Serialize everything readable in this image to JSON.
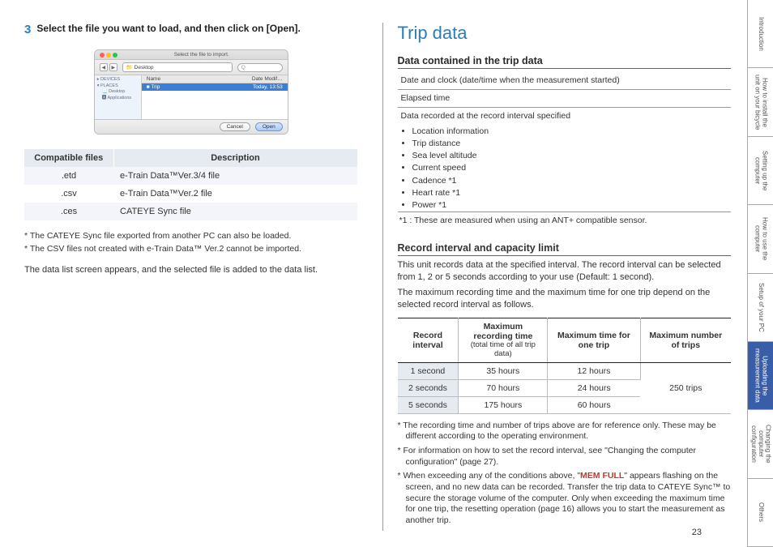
{
  "left": {
    "step_num": "3",
    "step_title": "Select the file you want to load, and then click on [Open].",
    "dialog": {
      "title": "Select the file to import.",
      "path": "📁 Desktop",
      "search_placeholder": "Q",
      "sidebar": {
        "devices": "▸ DEVICES",
        "places": "▾ PLACES",
        "desktop": "📃 Desktop",
        "apps": "🅰 Applications"
      },
      "list_hdr_name": "Name",
      "list_hdr_mod": "Date Modif…",
      "file_name": "■ Trip",
      "file_date": "Today, 13:53",
      "cancel": "Cancel",
      "open": "Open"
    },
    "table": {
      "h1": "Compatible files",
      "h2": "Description",
      "rows": [
        {
          "ext": ".etd",
          "desc": "e-Train Data™Ver.3/4 file"
        },
        {
          "ext": ".csv",
          "desc": "e-Train Data™Ver.2 file"
        },
        {
          "ext": ".ces",
          "desc": "CATEYE Sync file"
        }
      ]
    },
    "note1": "* The CATEYE Sync file exported from another PC can also be loaded.",
    "note2": "* The CSV files not created with e-Train Data™ Ver.2 cannot be imported.",
    "body": "The data list screen appears, and the selected file is added to the data list."
  },
  "right": {
    "heading": "Trip data",
    "sub1": "Data contained in the trip data",
    "data": {
      "r1": "Date and clock (date/time when the measurement started)",
      "r2": "Elapsed time",
      "r3": "Data recorded at the record interval specified",
      "items": [
        "Location information",
        "Trip distance",
        "Sea level altitude",
        "Current speed",
        "Cadence *1",
        "Heart rate *1",
        "Power *1"
      ],
      "foot": "*1 : These are measured when using an ANT+ compatible sensor."
    },
    "sub2": "Record interval and capacity limit",
    "para1": "This unit records data at the specified interval. The record interval can be selected from 1, 2 or 5 seconds according to your use (Default: 1 second).",
    "para2": "The maximum recording time and the maximum time for one trip depend on the selected record interval as follows.",
    "rec_table": {
      "h1": "Record interval",
      "h2": "Maximum recording time",
      "h2s": "(total time of all trip data)",
      "h3": "Maximum time for one trip",
      "h4": "Maximum number of trips",
      "rows": [
        {
          "i": "1 second",
          "t": "35 hours",
          "o": "12 hours"
        },
        {
          "i": "2 seconds",
          "t": "70 hours",
          "o": "24 hours"
        },
        {
          "i": "5 seconds",
          "t": "175 hours",
          "o": "60 hours"
        }
      ],
      "trips": "250 trips"
    },
    "n1": "* The recording time and number of trips above are for reference only. These may be different according to the operating environment.",
    "n2": "* For information on how to set the record interval, see \"Changing the computer configuration\" (page 27).",
    "n3a": "* When exceeding any of the conditions above, \"",
    "n3m": "MEM FULL",
    "n3b": "\" appears flashing on the screen, and no new data can be recorded. Transfer the trip data to CATEYE Sync™ to secure the storage volume of the computer. Only when exceeding the maximum time for one trip, the resetting operation (page 16) allows you to start the measurement as another trip."
  },
  "page_num": "23",
  "nav": [
    {
      "label": "Introduction",
      "active": false
    },
    {
      "label": "How to install the unit on your bicycle",
      "active": false
    },
    {
      "label": "Setting up the computer",
      "active": false
    },
    {
      "label": "How to use the computer",
      "active": false
    },
    {
      "label": "Setup of your PC",
      "active": false
    },
    {
      "label": "Uploading the measurement data",
      "active": true
    },
    {
      "label": "Changing the computer configuration",
      "active": false
    },
    {
      "label": "Others",
      "active": false
    }
  ]
}
